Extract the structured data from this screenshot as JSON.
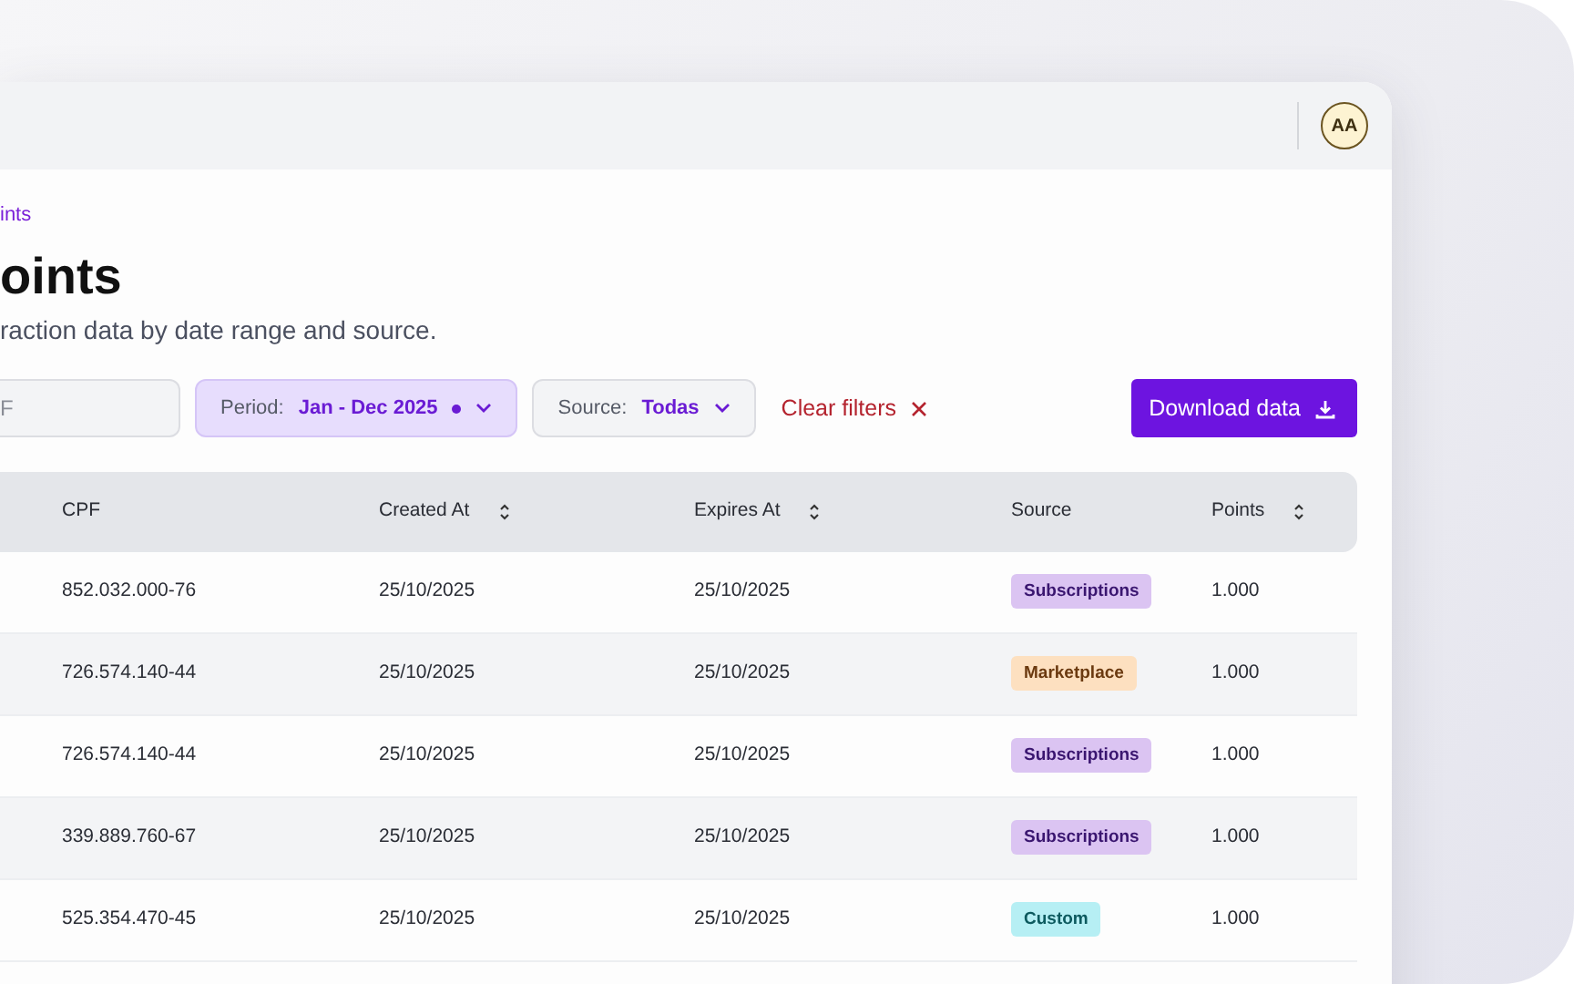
{
  "header": {
    "avatar": "AA"
  },
  "breadcrumb": "ints",
  "title": "oints",
  "subtitle": "raction data by date range and source.",
  "filters": {
    "search": {
      "placeholder": "F"
    },
    "period": {
      "label": "Period:",
      "value": "Jan - Dec 2025",
      "active": true
    },
    "source": {
      "label": "Source:",
      "value": "Todas"
    },
    "clear": "Clear filters",
    "download": "Download data"
  },
  "table": {
    "columns": [
      {
        "label": "CPF",
        "sortable": false
      },
      {
        "label": "Created At",
        "sortable": true
      },
      {
        "label": "Expires At",
        "sortable": true
      },
      {
        "label": "Source",
        "sortable": false
      },
      {
        "label": "Points",
        "sortable": true
      }
    ],
    "rows": [
      {
        "cpf": "852.032.000-76",
        "created": "25/10/2025",
        "expires": "25/10/2025",
        "source": {
          "label": "Subscriptions",
          "kind": "subscriptions"
        },
        "points": "1.000"
      },
      {
        "cpf": "726.574.140-44",
        "created": "25/10/2025",
        "expires": "25/10/2025",
        "source": {
          "label": "Marketplace",
          "kind": "marketplace"
        },
        "points": "1.000"
      },
      {
        "cpf": "726.574.140-44",
        "created": "25/10/2025",
        "expires": "25/10/2025",
        "source": {
          "label": "Subscriptions",
          "kind": "subscriptions"
        },
        "points": "1.000"
      },
      {
        "cpf": "339.889.760-67",
        "created": "25/10/2025",
        "expires": "25/10/2025",
        "source": {
          "label": "Subscriptions",
          "kind": "subscriptions"
        },
        "points": "1.000"
      },
      {
        "cpf": "525.354.470-45",
        "created": "25/10/2025",
        "expires": "25/10/2025",
        "source": {
          "label": "Custom",
          "kind": "custom"
        },
        "points": "1.000"
      }
    ]
  }
}
